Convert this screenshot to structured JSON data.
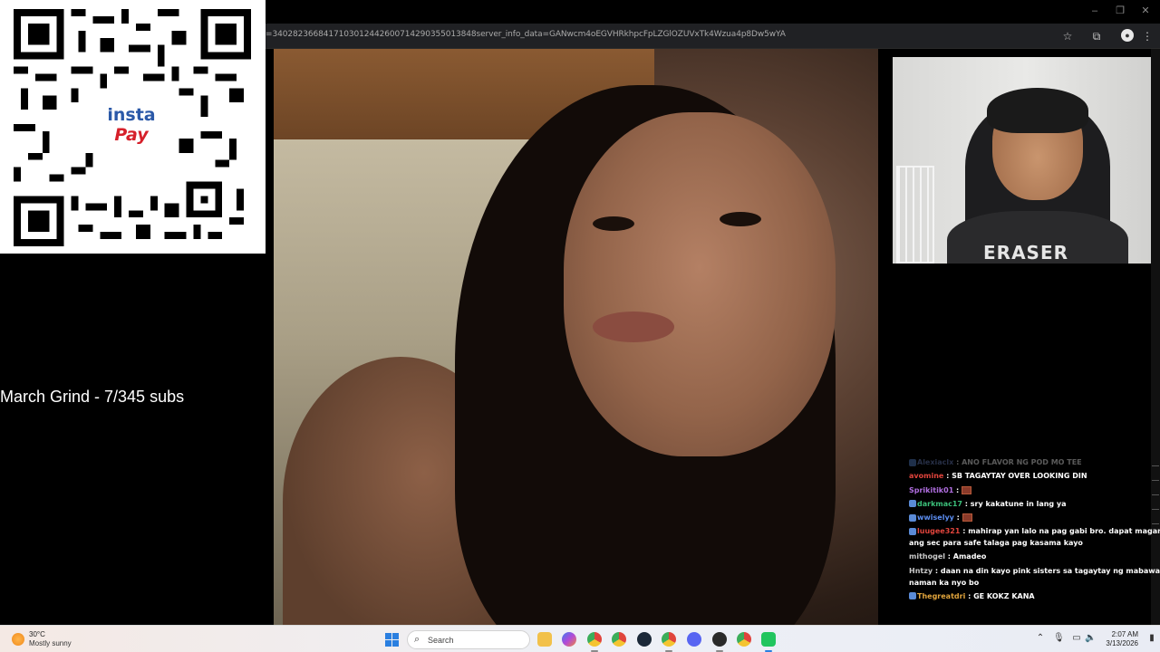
{
  "browser": {
    "url": "=3402823668417103012442600714290355013848server_info_data=GANwcm4oEGVHRkhpcFpLZGlOZUVxTk4Wzua4p8Dw5wYA",
    "window_controls": [
      "–",
      "❐",
      "✕"
    ]
  },
  "qr_overlay": {
    "logo_line1": "insta",
    "logo_line2": "Pay"
  },
  "goal_text": "March Grind - 7/345 subs",
  "webcam": {
    "shirt_text": "ERASER"
  },
  "chat": [
    {
      "nick": "Alexiaclx",
      "sep": " : ",
      "msg": "ANO FLAVOR NG POD MO TEE",
      "color": "#6f86c9",
      "faded": true,
      "badge": true
    },
    {
      "nick": "avomine",
      "sep": " : ",
      "msg": "SB TAGAYTAY OVER LOOKING DIN",
      "color": "#e0443c"
    },
    {
      "nick": "Sprikitik01",
      "sep": " : ",
      "msg": "",
      "color": "#b06ee0",
      "emote": true
    },
    {
      "nick": "darkmac17",
      "sep": " : ",
      "msg": "sry kakatune in lang ya",
      "color": "#3bbf7a",
      "badge": true
    },
    {
      "nick": "wwiselyy",
      "sep": " : ",
      "msg": "",
      "color": "#5b8df0",
      "badge": true,
      "emote": true
    },
    {
      "nick": "luugee321",
      "sep": " : ",
      "msg": "mahirap yan lalo na pag gabi bro. dapat maganda ang sec para safe talaga pag kasama kayo",
      "color": "#e0443c",
      "badge": true,
      "multi": true
    },
    {
      "nick": "mithogel",
      "sep": " : ",
      "msg": "Amadeo",
      "color": "#c9c9c9"
    },
    {
      "nick": "Hntzy",
      "sep": " : ",
      "msg": "daan na din kayo pink sisters sa tagaytay ng mabawasan naman ka nyo bo",
      "color": "#c9c9c9",
      "multi": true
    },
    {
      "nick": "Thegreatdri",
      "sep": " : ",
      "msg": "GE KOKZ KANA",
      "color": "#e0a43c",
      "badge": true
    }
  ],
  "taskbar": {
    "weather_temp": "30°C",
    "weather_desc": "Mostly sunny",
    "search_placeholder": "Search",
    "time": "2:07 AM",
    "date": "3/13/2026"
  },
  "colors": {
    "taskbar_bg": "#eef0f6",
    "accent_blue": "#2a7fe0"
  }
}
